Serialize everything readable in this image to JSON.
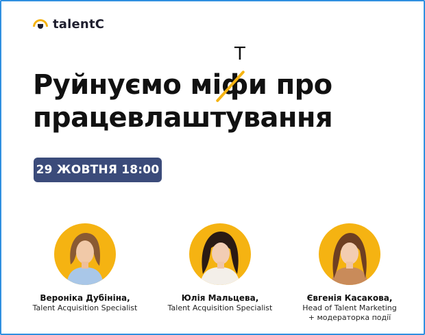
{
  "brand": {
    "name": "talentC",
    "accent": "#f5b312",
    "badge_color": "#3b4b7a"
  },
  "headline": {
    "line1_before": "Руйнуємо м",
    "line1_struck": "іф",
    "line1_after": "и про",
    "correction": "Т",
    "line2": "працевлаштування"
  },
  "event": {
    "date_time": "29 ЖОВТНЯ 18:00"
  },
  "speakers": [
    {
      "name": "Вероніка Дубініна,",
      "role": "Talent Acquisition Specialist",
      "role2": ""
    },
    {
      "name": "Юлія Мальцева,",
      "role": "Talent Acquisition Specialist",
      "role2": ""
    },
    {
      "name": "Євгенія Касакова,",
      "role": "Head of Talent Marketing",
      "role2": "+ модераторка події"
    }
  ]
}
